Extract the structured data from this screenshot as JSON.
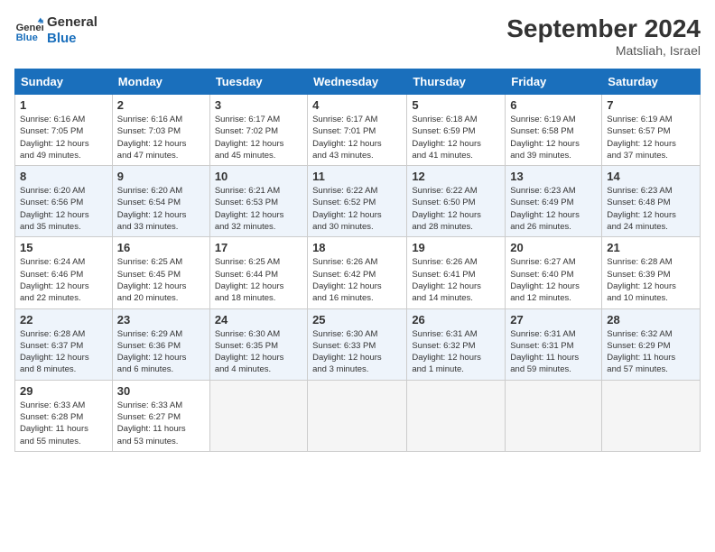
{
  "logo": {
    "name_part1": "General",
    "name_part2": "Blue"
  },
  "header": {
    "month_year": "September 2024",
    "location": "Matsliah, Israel"
  },
  "weekdays": [
    "Sunday",
    "Monday",
    "Tuesday",
    "Wednesday",
    "Thursday",
    "Friday",
    "Saturday"
  ],
  "weeks": [
    [
      {
        "day": "1",
        "info": "Sunrise: 6:16 AM\nSunset: 7:05 PM\nDaylight: 12 hours\nand 49 minutes."
      },
      {
        "day": "2",
        "info": "Sunrise: 6:16 AM\nSunset: 7:03 PM\nDaylight: 12 hours\nand 47 minutes."
      },
      {
        "day": "3",
        "info": "Sunrise: 6:17 AM\nSunset: 7:02 PM\nDaylight: 12 hours\nand 45 minutes."
      },
      {
        "day": "4",
        "info": "Sunrise: 6:17 AM\nSunset: 7:01 PM\nDaylight: 12 hours\nand 43 minutes."
      },
      {
        "day": "5",
        "info": "Sunrise: 6:18 AM\nSunset: 6:59 PM\nDaylight: 12 hours\nand 41 minutes."
      },
      {
        "day": "6",
        "info": "Sunrise: 6:19 AM\nSunset: 6:58 PM\nDaylight: 12 hours\nand 39 minutes."
      },
      {
        "day": "7",
        "info": "Sunrise: 6:19 AM\nSunset: 6:57 PM\nDaylight: 12 hours\nand 37 minutes."
      }
    ],
    [
      {
        "day": "8",
        "info": "Sunrise: 6:20 AM\nSunset: 6:56 PM\nDaylight: 12 hours\nand 35 minutes."
      },
      {
        "day": "9",
        "info": "Sunrise: 6:20 AM\nSunset: 6:54 PM\nDaylight: 12 hours\nand 33 minutes."
      },
      {
        "day": "10",
        "info": "Sunrise: 6:21 AM\nSunset: 6:53 PM\nDaylight: 12 hours\nand 32 minutes."
      },
      {
        "day": "11",
        "info": "Sunrise: 6:22 AM\nSunset: 6:52 PM\nDaylight: 12 hours\nand 30 minutes."
      },
      {
        "day": "12",
        "info": "Sunrise: 6:22 AM\nSunset: 6:50 PM\nDaylight: 12 hours\nand 28 minutes."
      },
      {
        "day": "13",
        "info": "Sunrise: 6:23 AM\nSunset: 6:49 PM\nDaylight: 12 hours\nand 26 minutes."
      },
      {
        "day": "14",
        "info": "Sunrise: 6:23 AM\nSunset: 6:48 PM\nDaylight: 12 hours\nand 24 minutes."
      }
    ],
    [
      {
        "day": "15",
        "info": "Sunrise: 6:24 AM\nSunset: 6:46 PM\nDaylight: 12 hours\nand 22 minutes."
      },
      {
        "day": "16",
        "info": "Sunrise: 6:25 AM\nSunset: 6:45 PM\nDaylight: 12 hours\nand 20 minutes."
      },
      {
        "day": "17",
        "info": "Sunrise: 6:25 AM\nSunset: 6:44 PM\nDaylight: 12 hours\nand 18 minutes."
      },
      {
        "day": "18",
        "info": "Sunrise: 6:26 AM\nSunset: 6:42 PM\nDaylight: 12 hours\nand 16 minutes."
      },
      {
        "day": "19",
        "info": "Sunrise: 6:26 AM\nSunset: 6:41 PM\nDaylight: 12 hours\nand 14 minutes."
      },
      {
        "day": "20",
        "info": "Sunrise: 6:27 AM\nSunset: 6:40 PM\nDaylight: 12 hours\nand 12 minutes."
      },
      {
        "day": "21",
        "info": "Sunrise: 6:28 AM\nSunset: 6:39 PM\nDaylight: 12 hours\nand 10 minutes."
      }
    ],
    [
      {
        "day": "22",
        "info": "Sunrise: 6:28 AM\nSunset: 6:37 PM\nDaylight: 12 hours\nand 8 minutes."
      },
      {
        "day": "23",
        "info": "Sunrise: 6:29 AM\nSunset: 6:36 PM\nDaylight: 12 hours\nand 6 minutes."
      },
      {
        "day": "24",
        "info": "Sunrise: 6:30 AM\nSunset: 6:35 PM\nDaylight: 12 hours\nand 4 minutes."
      },
      {
        "day": "25",
        "info": "Sunrise: 6:30 AM\nSunset: 6:33 PM\nDaylight: 12 hours\nand 3 minutes."
      },
      {
        "day": "26",
        "info": "Sunrise: 6:31 AM\nSunset: 6:32 PM\nDaylight: 12 hours\nand 1 minute."
      },
      {
        "day": "27",
        "info": "Sunrise: 6:31 AM\nSunset: 6:31 PM\nDaylight: 11 hours\nand 59 minutes."
      },
      {
        "day": "28",
        "info": "Sunrise: 6:32 AM\nSunset: 6:29 PM\nDaylight: 11 hours\nand 57 minutes."
      }
    ],
    [
      {
        "day": "29",
        "info": "Sunrise: 6:33 AM\nSunset: 6:28 PM\nDaylight: 11 hours\nand 55 minutes."
      },
      {
        "day": "30",
        "info": "Sunrise: 6:33 AM\nSunset: 6:27 PM\nDaylight: 11 hours\nand 53 minutes."
      },
      null,
      null,
      null,
      null,
      null
    ]
  ]
}
